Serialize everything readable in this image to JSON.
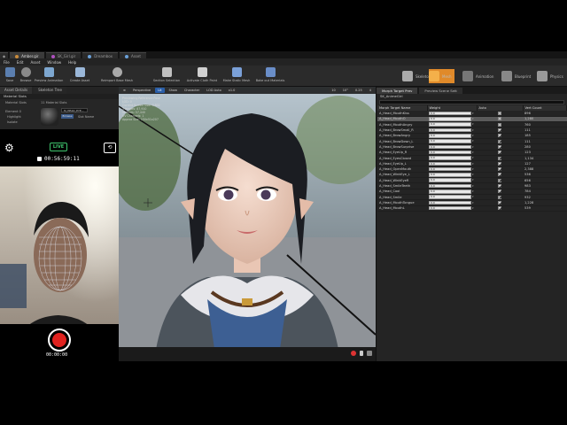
{
  "tabs": [
    {
      "label": "Amber.gir"
    },
    {
      "label": "SK_Girl.gir"
    },
    {
      "label": "Dreambox"
    },
    {
      "label": "Asset"
    }
  ],
  "menu": [
    "File",
    "Edit",
    "Asset",
    "Window",
    "Help"
  ],
  "toolbar": [
    {
      "label": "Save",
      "icon": "save-icon"
    },
    {
      "label": "Browse",
      "icon": "browse-icon"
    },
    {
      "label": "Preview Animation",
      "icon": "preview-animation-icon"
    },
    {
      "label": "Create Asset",
      "icon": "create-asset-icon"
    },
    {
      "label": "Reimport Base Mesh",
      "icon": "reimport-icon"
    },
    {
      "label": "Section Selection",
      "icon": "section-selection-icon"
    },
    {
      "label": "Activate Cloth Paint",
      "icon": "cloth-paint-icon"
    },
    {
      "label": "Make Static Mesh",
      "icon": "static-mesh-icon"
    },
    {
      "label": "Bake out Materials",
      "icon": "bake-icon"
    }
  ],
  "modes": [
    "Skeleton",
    "Mesh",
    "Animation",
    "Blueprint",
    "Physics"
  ],
  "left_tabs": [
    "Asset Details",
    "Skeleton Tree"
  ],
  "material_slots": {
    "header": "Material Slots",
    "row_label": "Material Slots",
    "count": "11 Material Slots",
    "element": "Element 0",
    "highlight": "Highlight",
    "isolate": "Isolate",
    "material_name": "M_HEAD_EYE...",
    "slot_button": "Browse",
    "slot_name": "Slot Name"
  },
  "overlay": {
    "live_label": "LIVE",
    "session_timer": "00:56:59:11",
    "record_timer": "00:00:00"
  },
  "viewport": {
    "buttons": [
      "Perspective",
      "Lit",
      "Show",
      "Character",
      "LOD Auto",
      "x1.0"
    ],
    "info_lines": [
      "Previewing Reference Pose",
      "LOD: 0",
      "Current Screen Size: 0.802",
      "Triangles: 87,910",
      "Vertices: 57,440",
      "UV Channels: 1",
      "Approx Size: 150x51x207"
    ],
    "right_buttons": [
      "10",
      "10°",
      "0.25",
      "4"
    ],
    "colors": {
      "record": "#e0221f",
      "live": "#3ec46d",
      "accent": "#2a5ea8"
    }
  },
  "right_panel": {
    "tabs": [
      "Morph Target Prev",
      "Preview Scene Sett"
    ],
    "anim_label": "SK_AnimeGirl",
    "columns": [
      "Morph Target Name",
      "Weight",
      "Auto",
      "Vert Count"
    ],
    "rows": [
      {
        "name": "A_Head_MouthKiss",
        "weight": "0.0",
        "auto": false,
        "vert": "896",
        "selected": false
      },
      {
        "name": "A_Head_MouthO",
        "weight": "0.0",
        "auto": false,
        "vert": "1,280",
        "selected": true
      },
      {
        "name": "A_Head_MouthAngry",
        "weight": "0.0",
        "auto": false,
        "vert": "760",
        "selected": false
      },
      {
        "name": "A_Head_BrowSmall_R",
        "weight": "0.0",
        "auto": true,
        "vert": "111",
        "selected": false
      },
      {
        "name": "A_Head_BrowAngry",
        "weight": "0.0",
        "auto": true,
        "vert": "185",
        "selected": false
      },
      {
        "name": "A_Head_BrowDown_L",
        "weight": "0.0",
        "auto": true,
        "vert": "111",
        "selected": false
      },
      {
        "name": "A_Head_BrowSurprise",
        "weight": "0.0",
        "auto": true,
        "vert": "280",
        "selected": false
      },
      {
        "name": "A_Head_EyeUp_R",
        "weight": "0.0",
        "auto": true,
        "vert": "123",
        "selected": false
      },
      {
        "name": "A_Head_EyesClosed",
        "weight": "0.0",
        "auto": true,
        "vert": "1,134",
        "selected": false
      },
      {
        "name": "A_Head_EyeUp_L",
        "weight": "0.0",
        "auto": true,
        "vert": "127",
        "selected": false
      },
      {
        "name": "A_Head_OpenMouth",
        "weight": "0.0",
        "auto": true,
        "vert": "2,388",
        "selected": false
      },
      {
        "name": "A_Head_WinkEye_L",
        "weight": "0.0",
        "auto": true,
        "vert": "536",
        "selected": false
      },
      {
        "name": "A_Head_WinkEyeR",
        "weight": "0.0",
        "auto": true,
        "vert": "656",
        "selected": false
      },
      {
        "name": "A_Head_SmileTeeth",
        "weight": "0.0",
        "auto": true,
        "vert": "983",
        "selected": false
      },
      {
        "name": "A_Head_Cool",
        "weight": "0.0",
        "auto": true,
        "vert": "784",
        "selected": false
      },
      {
        "name": "A_Head_Smile",
        "weight": "0.0",
        "auto": true,
        "vert": "932",
        "selected": false
      },
      {
        "name": "A_Head_MouthTongue",
        "weight": "0.0",
        "auto": true,
        "vert": "1,228",
        "selected": false
      },
      {
        "name": "A_Head_MouthL",
        "weight": "0.0",
        "auto": true,
        "vert": "539",
        "selected": false
      }
    ]
  }
}
